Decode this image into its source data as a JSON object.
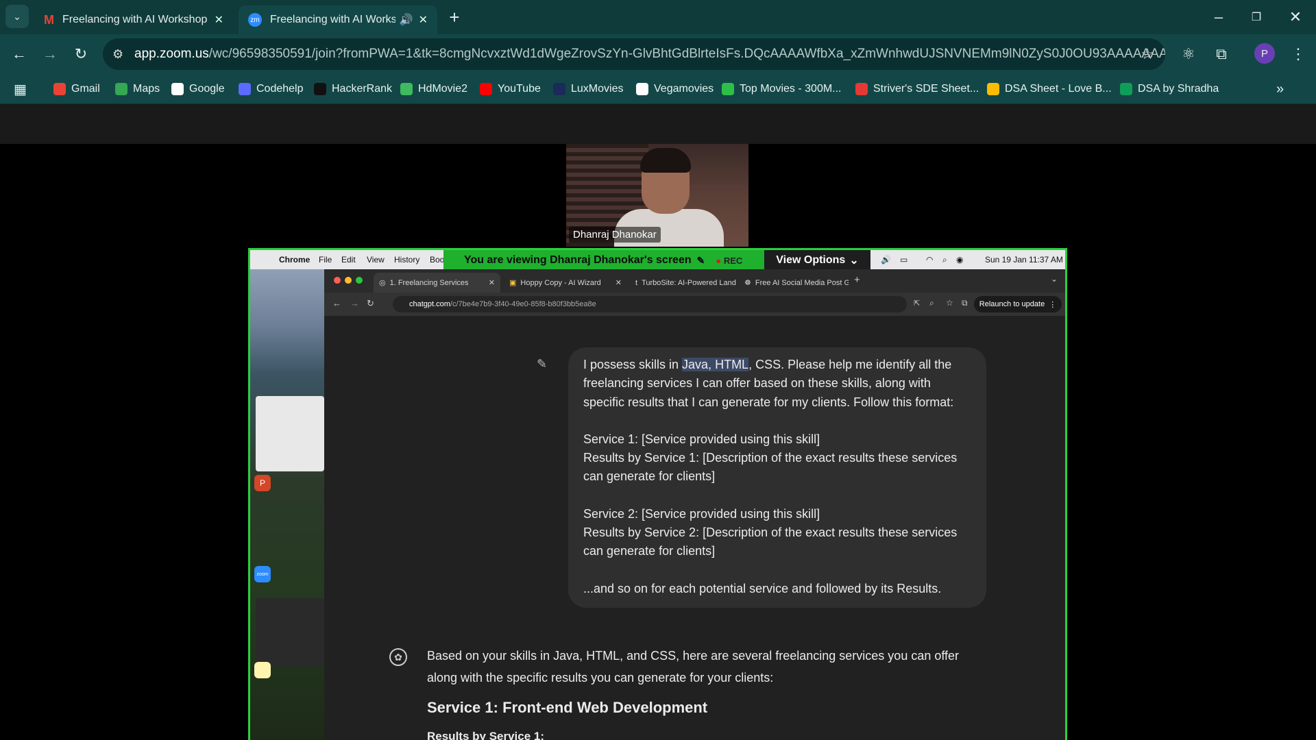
{
  "browser": {
    "tabs": [
      {
        "title": "Freelancing with AI Workshop (",
        "icon": "gmail-icon"
      },
      {
        "title": "Freelancing with AI Worksh",
        "icon": "zoom-icon"
      }
    ],
    "url_host": "app.zoom.us",
    "url_rest": "/wc/96598350591/join?fromPWA=1&tk=8cmgNcvxztWd1dWgeZrovSzYn-GlvBhtGdBlrteIsFs.DQcAAAAWfbXa_xZmWnhwdUJSNVNEMm9lN0ZyS0J0OU93AAAAAAAAAAAAAA...",
    "profile_initial": "P",
    "bookmarks": [
      {
        "label": "Gmail",
        "color": "#ea4335"
      },
      {
        "label": "Maps",
        "color": "#34a853"
      },
      {
        "label": "Google",
        "color": "#ffffff"
      },
      {
        "label": "Codehelp",
        "color": "#5b6bff"
      },
      {
        "label": "HackerRank",
        "color": "#111111"
      },
      {
        "label": "HdMovie2",
        "color": "#3dbb5e"
      },
      {
        "label": "YouTube",
        "color": "#ff0000"
      },
      {
        "label": "LuxMovies",
        "color": "#1b2a5a"
      },
      {
        "label": "Vegamovies",
        "color": "#ffffff"
      },
      {
        "label": "Top Movies - 300M...",
        "color": "#2dbf4a"
      },
      {
        "label": "Striver's SDE Sheet...",
        "color": "#e53935"
      },
      {
        "label": "DSA Sheet - Love B...",
        "color": "#fbbc04"
      },
      {
        "label": "DSA by Shradha",
        "color": "#0f9d58"
      }
    ]
  },
  "zoom": {
    "participant_name": "Dhanraj Dhanokar",
    "banner_text": "You are viewing  Dhanraj Dhanokar's screen",
    "rec_label": "REC",
    "view_options": "View Options"
  },
  "mac": {
    "menu": [
      "Chrome",
      "File",
      "Edit",
      "View",
      "History",
      "Boo"
    ],
    "clock": "Sun 19 Jan  11:37 AM"
  },
  "inner_browser": {
    "tabs": [
      "1. Freelancing Services",
      "Hoppy Copy - AI Wizard",
      "TurboSite: AI-Powered Landi",
      "Free AI Social Media Post Ge"
    ],
    "url_host": "chatgpt.com",
    "url_rest": "/c/7be4e7b9-3f40-49e0-85f8-b80f3bb5ea8e",
    "relaunch": "Relaunch to update"
  },
  "chat": {
    "user_pre": "I possess skills in ",
    "user_hl": "Java, HTML",
    "user_post": ", CSS. Please help me identify all the freelancing services I can offer based on these skills, along with specific results that I can generate for my clients. Follow this format:",
    "s1": "Service 1: [Service provided using this skill]",
    "r1": "Results by Service 1: [Description of the exact results these services can generate for clients]",
    "s2": "Service 2: [Service provided using this skill]",
    "r2": "Results by Service 2: [Description of the exact results these services can generate for clients]",
    "end": "...and so on for each potential service and followed by its Results.",
    "reply_intro": "Based on your skills in Java, HTML, and CSS, here are several freelancing services you can offer along with the specific results you can generate for your clients:",
    "reply_h": "Service 1: Front-end Web Development",
    "reply_sub": "Results by Service 1:"
  }
}
